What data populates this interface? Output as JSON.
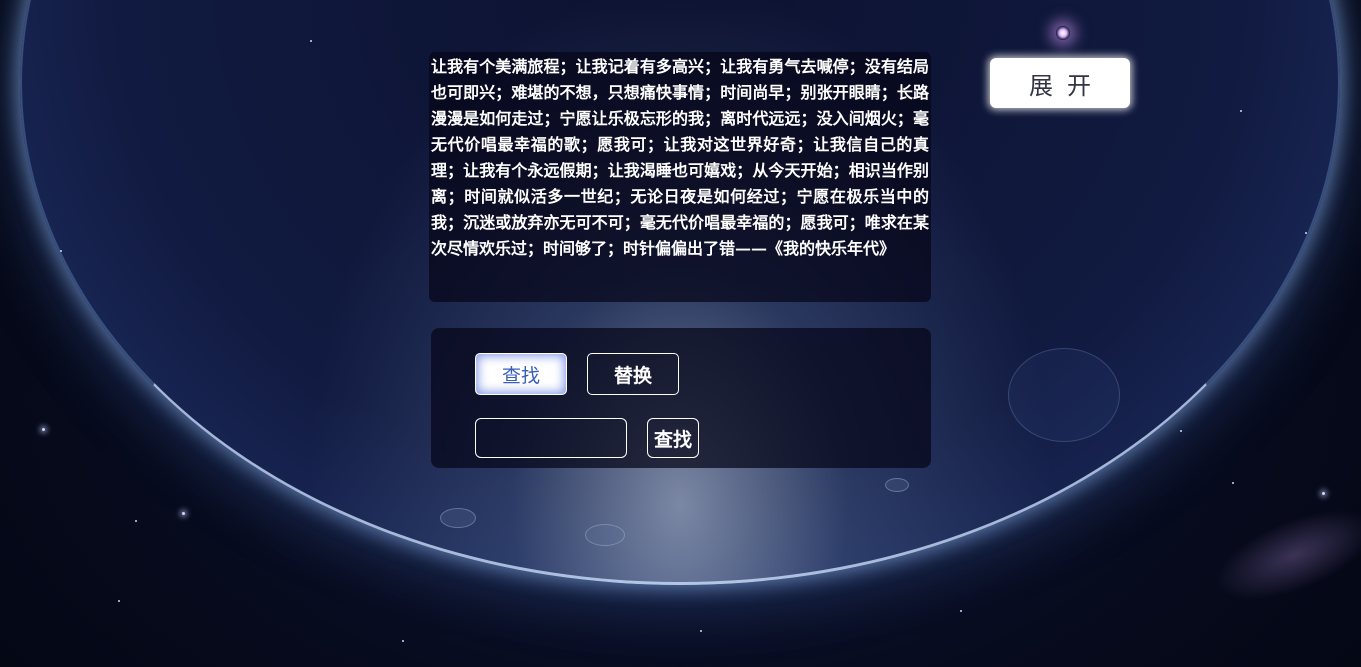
{
  "poem": {
    "text": "让我有个美满旅程；让我记着有多高兴；让我有勇气去喊停；没有结局也可即兴；难堪的不想，只想痛快事情；时间尚早；别张开眼睛；长路漫漫是如何走过；宁愿让乐极忘形的我；离时代远远；没入间烟火；毫无代价唱最幸福的歌；愿我可；让我对这世界好奇；让我信自己的真理；让我有个永远假期；让我渴睡也可嬉戏；从今天开始；相识当作别离；时间就似活多一世纪；无论日夜是如何经过；宁愿在极乐当中的我；沉迷或放弃亦无可不可；毫无代价唱最幸福的；愿我可；唯求在某次尽情欢乐过；时间够了；时针偏偏出了错——《我的快乐年代》"
  },
  "expand_button": {
    "label": "展开"
  },
  "tools": {
    "tabs": [
      {
        "label": "查找",
        "active": true
      },
      {
        "label": "替换",
        "active": false
      }
    ],
    "search_input": {
      "value": "",
      "placeholder": ""
    },
    "submit_label": "查找"
  },
  "colors": {
    "active_tab_text": "#3a5fb8",
    "panel_bg": "#060618",
    "text": "#ffffff"
  }
}
